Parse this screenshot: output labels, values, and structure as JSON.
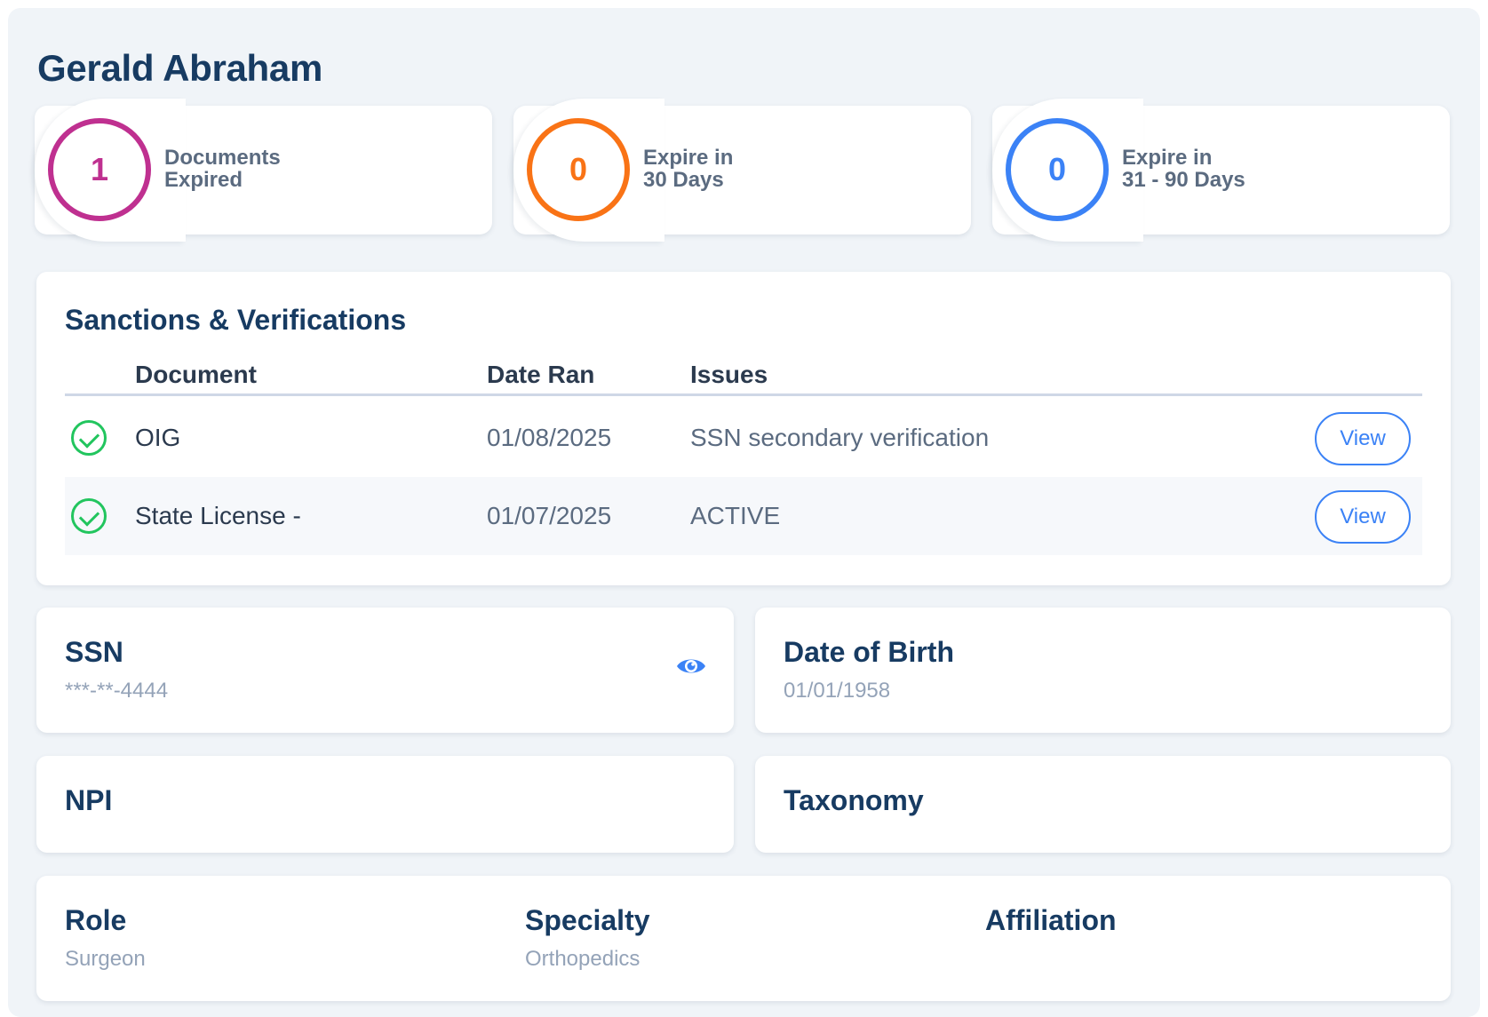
{
  "profile": {
    "name": "Gerald Abraham"
  },
  "stats": [
    {
      "value": "1",
      "line1": "Documents",
      "line2": "Expired",
      "color": "#bf3090"
    },
    {
      "value": "0",
      "line1": "Expire in",
      "line2": "30 Days",
      "color": "#f97316"
    },
    {
      "value": "0",
      "line1": "Expire in",
      "line2": "31 - 90 Days",
      "color": "#3b82f6"
    }
  ],
  "sanctions": {
    "title": "Sanctions & Verifications",
    "columns": [
      "Document",
      "Date Ran",
      "Issues"
    ],
    "rows": [
      {
        "document": "OIG",
        "date_ran": "01/08/2025",
        "issues": "SSN secondary verification",
        "action": "View",
        "status_icon": "check-circle-icon"
      },
      {
        "document": "State License -",
        "date_ran": "01/07/2025",
        "issues": "ACTIVE",
        "action": "View",
        "status_icon": "check-circle-icon"
      }
    ]
  },
  "fields": {
    "ssn": {
      "label": "SSN",
      "value": "***-**-4444"
    },
    "dob": {
      "label": "Date of Birth",
      "value": "01/01/1958"
    },
    "npi": {
      "label": "NPI"
    },
    "taxonomy": {
      "label": "Taxonomy"
    },
    "role": {
      "label": "Role",
      "value": "Surgeon"
    },
    "specialty": {
      "label": "Specialty",
      "value": "Orthopedics"
    },
    "affiliation": {
      "label": "Affiliation"
    }
  },
  "colors": {
    "accent": "#3b82f6",
    "heading": "#173b62",
    "success": "#22c55e"
  }
}
